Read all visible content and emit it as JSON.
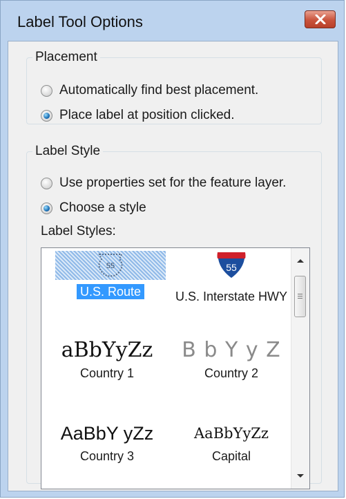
{
  "window": {
    "title": "Label Tool Options",
    "close_icon": "close-icon"
  },
  "placement": {
    "legend": "Placement",
    "options": [
      {
        "label": "Automatically find best placement.",
        "checked": false
      },
      {
        "label": "Place label at position clicked.",
        "checked": true
      }
    ]
  },
  "label_style": {
    "legend": "Label Style",
    "options": [
      {
        "label": "Use properties set for the feature layer.",
        "checked": false
      },
      {
        "label": "Choose a style",
        "checked": true
      }
    ],
    "list_label": "Label Styles:",
    "items": [
      {
        "name": "U.S. Route",
        "preview_icon": "us-route-shield-icon",
        "preview_text": "55",
        "selected": true
      },
      {
        "name": "U.S. Interstate HWY",
        "preview_icon": "interstate-shield-icon",
        "preview_text": "55",
        "selected": false
      },
      {
        "name": "Country 1",
        "preview_text": "aBbYyZz",
        "selected": false
      },
      {
        "name": "Country 2",
        "preview_text": "B b Y y Z",
        "selected": false
      },
      {
        "name": "Country 3",
        "preview_text": "AaBbY yZz",
        "selected": false
      },
      {
        "name": "Capital",
        "preview_text": "AaBbYyZz",
        "selected": false
      }
    ]
  },
  "colors": {
    "selection": "#3399ff",
    "close_button": "#c9533c",
    "interstate_red": "#d0202a",
    "interstate_blue": "#1c4e9e"
  }
}
